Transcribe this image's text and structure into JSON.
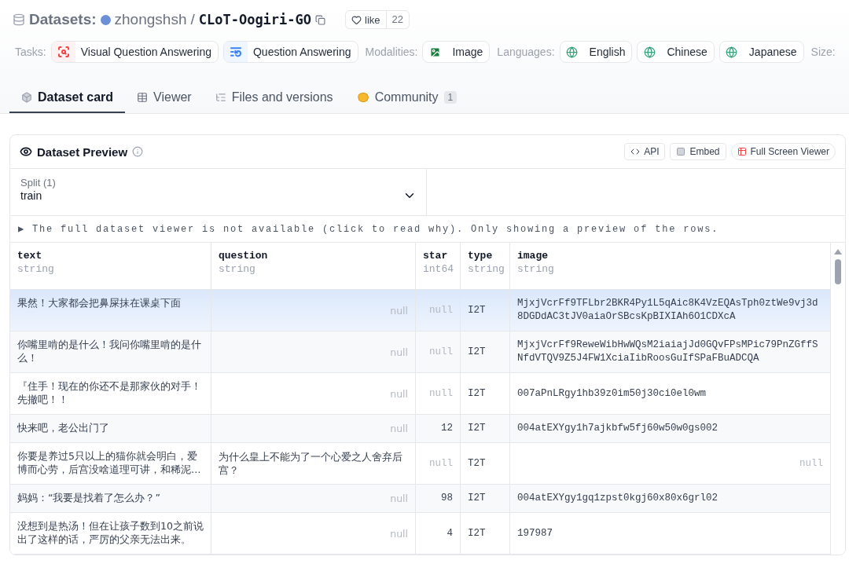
{
  "header": {
    "section": "Datasets:",
    "owner": "zhongshsh",
    "separator": "/",
    "name": "CLoT-Oogiri-GO",
    "like_label": "like",
    "like_count": "22"
  },
  "tags": [
    {
      "kind": "label",
      "text": "Tasks:"
    },
    {
      "kind": "task",
      "text": "Visual Question Answering",
      "color": "#ef4444"
    },
    {
      "kind": "qa",
      "text": "Question Answering",
      "color": "#3b82f6"
    },
    {
      "kind": "label",
      "text": "Modalities:"
    },
    {
      "kind": "image",
      "text": "Image",
      "color": "#15803d"
    },
    {
      "kind": "label",
      "text": "Languages:"
    },
    {
      "kind": "language",
      "text": "English",
      "color": "#34a37a"
    },
    {
      "kind": "language",
      "text": "Chinese",
      "color": "#34a37a"
    },
    {
      "kind": "language",
      "text": "Japanese",
      "color": "#34a37a"
    },
    {
      "kind": "label",
      "text": "Size:"
    }
  ],
  "tabs": [
    {
      "kind": "card",
      "label": "Dataset card",
      "selected": true
    },
    {
      "kind": "viewer",
      "label": "Viewer",
      "selected": false
    },
    {
      "kind": "files",
      "label": "Files and versions",
      "selected": false
    },
    {
      "kind": "community",
      "label": "Community",
      "count": "1",
      "selected": false
    }
  ],
  "preview": {
    "title": "Dataset Preview",
    "buttons": [
      {
        "kind": "api",
        "label": "API"
      },
      {
        "kind": "embed",
        "label": "Embed"
      },
      {
        "kind": "full",
        "label": "Full Screen Viewer"
      }
    ],
    "split_label": "Split (1)",
    "split_value": "train",
    "notice": "▶ The full dataset viewer is not available (click to read why). Only showing a preview of the rows.",
    "columns": [
      {
        "name": "text",
        "type": "string"
      },
      {
        "name": "question",
        "type": "string"
      },
      {
        "name": "star",
        "type": "int64"
      },
      {
        "name": "type",
        "type": "string"
      },
      {
        "name": "image",
        "type": "string"
      }
    ],
    "rows": [
      {
        "selected": true,
        "cells": [
          {
            "text": "果然！大家都会把鼻屎抹在课桌下面",
            "null": false
          },
          {
            "text": "null",
            "null": true
          },
          {
            "text": "null",
            "null": true
          },
          {
            "text": "I2T",
            "null": false
          },
          {
            "text": "MjxjVcrFf9TFLbr2BKR4Py1L5qAic8K4VzEQAsTph0ztWe9vj3d8DGDdAC3tJV0aiaOrSBcsKpBIXIAh6O1CDXcA",
            "null": false
          }
        ]
      },
      {
        "selected": false,
        "cells": [
          {
            "text": "你嘴里啃的是什么！我问你嘴里啃的是什么！",
            "null": false
          },
          {
            "text": "null",
            "null": true
          },
          {
            "text": "null",
            "null": true
          },
          {
            "text": "I2T",
            "null": false
          },
          {
            "text": "MjxjVcrFf9ReweWibHwWQsM2iaiajJd0GQvFPsMPic79PnZGffSNfdVTQV9Z5J4FW1XciaIibRoosGuIfSPaFBuADCQA",
            "null": false
          }
        ]
      },
      {
        "selected": false,
        "cells": [
          {
            "text": "『住手！现在的你还不是那家伙的对手！先撤吧！！",
            "null": false
          },
          {
            "text": "null",
            "null": true
          },
          {
            "text": "null",
            "null": true
          },
          {
            "text": "I2T",
            "null": false
          },
          {
            "text": "007aPnLRgy1hb39z0im50j30ci0el0wm",
            "null": false
          }
        ]
      },
      {
        "selected": false,
        "cells": [
          {
            "text": "快来吧，老公出门了",
            "null": false
          },
          {
            "text": "null",
            "null": true
          },
          {
            "text": "12",
            "null": false
          },
          {
            "text": "I2T",
            "null": false
          },
          {
            "text": "004atEXYgy1h7ajkbfw5fj60w50w0gs002",
            "null": false
          }
        ]
      },
      {
        "selected": false,
        "cells": [
          {
            "text": "你要是养过5只以上的猫你就会明白，爱博而心劳，后宫没啥道理可讲，和稀泥…",
            "null": false
          },
          {
            "text": "为什么皇上不能为了一个心爱之人舍弃后宫？",
            "null": false
          },
          {
            "text": "null",
            "null": true
          },
          {
            "text": "T2T",
            "null": false
          },
          {
            "text": "null",
            "null": true
          }
        ]
      },
      {
        "selected": false,
        "cells": [
          {
            "text": "妈妈：“我要是找着了怎么办？”",
            "null": false
          },
          {
            "text": "null",
            "null": true
          },
          {
            "text": "98",
            "null": false
          },
          {
            "text": "I2T",
            "null": false
          },
          {
            "text": "004atEXYgy1gq1zpst0kgj60x80x6grl02",
            "null": false
          }
        ]
      },
      {
        "selected": false,
        "cells": [
          {
            "text": "没想到是热汤！但在让孩子数到10之前说出了这样的话，严厉的父亲无法出来。",
            "null": false
          },
          {
            "text": "null",
            "null": true
          },
          {
            "text": "4",
            "null": false
          },
          {
            "text": "I2T",
            "null": false
          },
          {
            "text": "197987",
            "null": false
          }
        ]
      }
    ]
  }
}
